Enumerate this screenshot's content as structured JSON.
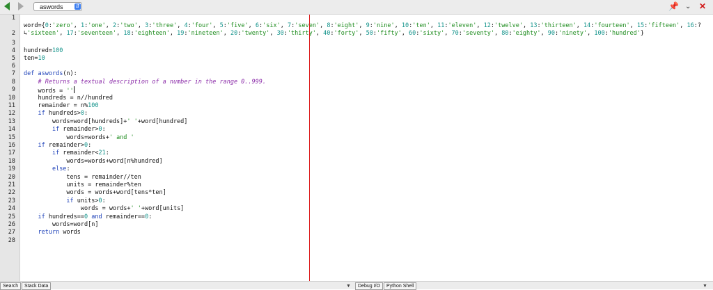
{
  "toolbar": {
    "file_name": "aswords",
    "back_icon": "back-arrow-icon",
    "forward_icon": "forward-arrow-icon",
    "pin_icon": "pin-icon",
    "menu_icon": "chevron-down-icon",
    "close_icon": "close-icon"
  },
  "editor": {
    "line_numbers": [
      "1",
      "2",
      "3",
      "4",
      "5",
      "6",
      "7",
      "8",
      "9",
      "10",
      "11",
      "12",
      "13",
      "14",
      "15",
      "16",
      "17",
      "18",
      "19",
      "20",
      "21",
      "22",
      "23",
      "24",
      "25",
      "26",
      "27",
      "28"
    ]
  },
  "bottom": {
    "search_tab": "Search",
    "stack_tab": "Stack Data",
    "debug_tab": "Debug I/O",
    "shell_tab": "Python Shell"
  },
  "colors": {
    "keyword": "#1b3fb8",
    "string": "#1c8b1c",
    "number": "#11928a",
    "comment": "#8a2aa8",
    "margin_line": "#dd2222"
  }
}
